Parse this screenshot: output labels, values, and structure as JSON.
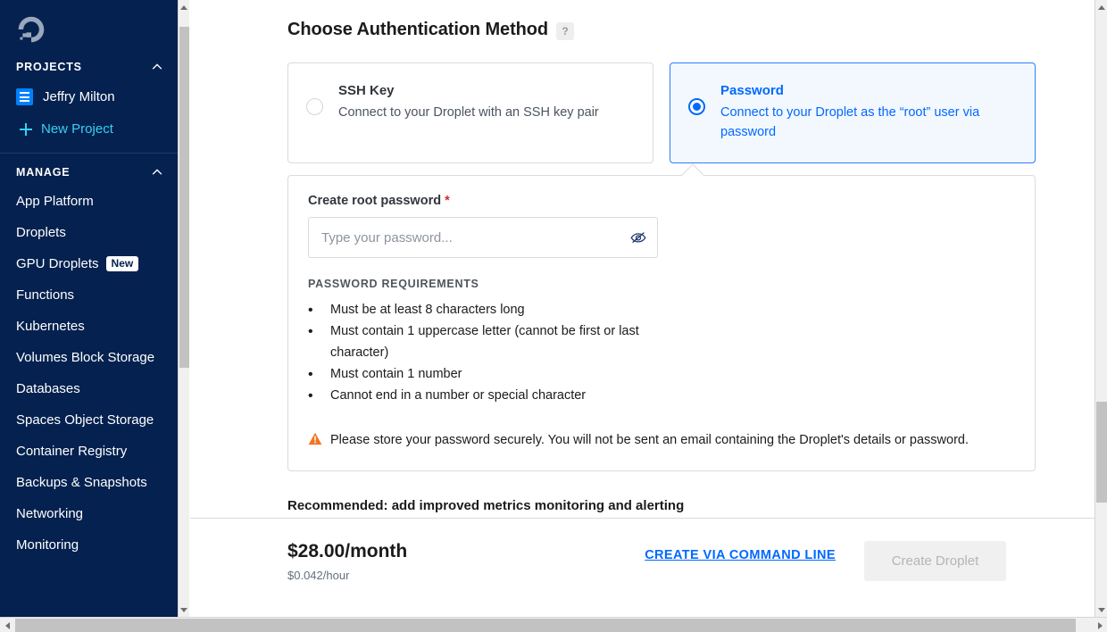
{
  "sidebar": {
    "logo_icon": "digitalocean-logo",
    "projects_section": {
      "label": "PROJECTS",
      "collapse_icon": "chevron-up-icon",
      "project_name": "Jeffry Milton",
      "project_icon": "project-list-icon",
      "new_project_label": "New Project",
      "new_project_icon": "plus-icon"
    },
    "manage_section": {
      "label": "MANAGE",
      "collapse_icon": "chevron-up-icon",
      "items": [
        {
          "label": "App Platform"
        },
        {
          "label": "Droplets"
        },
        {
          "label": "GPU Droplets",
          "badge": "New"
        },
        {
          "label": "Functions"
        },
        {
          "label": "Kubernetes"
        },
        {
          "label": "Volumes Block Storage"
        },
        {
          "label": "Databases"
        },
        {
          "label": "Spaces Object Storage"
        },
        {
          "label": "Container Registry"
        },
        {
          "label": "Backups & Snapshots"
        },
        {
          "label": "Networking"
        },
        {
          "label": "Monitoring"
        }
      ]
    }
  },
  "main": {
    "page_title": "Choose Authentication Method",
    "help_badge": "?",
    "auth_methods": [
      {
        "title": "SSH Key",
        "description": "Connect to your Droplet with an SSH key pair",
        "selected": false
      },
      {
        "title": "Password",
        "description": "Connect to your Droplet as the “root” user via password",
        "selected": true
      }
    ],
    "password_panel": {
      "field_label": "Create root password",
      "required_mark": "*",
      "input_placeholder": "Type your password...",
      "input_value": "",
      "toggle_icon": "eye-slash-icon",
      "requirements_heading": "PASSWORD REQUIREMENTS",
      "requirements": [
        "Must be at least 8 characters long",
        "Must contain 1 uppercase letter (cannot be first or last character)",
        "Must contain 1 number",
        "Cannot end in a number or special character"
      ],
      "warning_icon": "warning-triangle-icon",
      "warning_text": "Please store your password securely. You will not be sent an email containing the Droplet's details or password."
    },
    "next_section_peek": "Recommended: add improved metrics monitoring and alerting"
  },
  "footer": {
    "price_monthly": "$28.00/month",
    "price_hourly": "$0.042/hour",
    "cli_link_label": "CREATE VIA COMMAND LINE",
    "create_button_label": "Create Droplet",
    "create_button_disabled": true
  },
  "colors": {
    "sidebar_bg": "#04214f",
    "accent_blue": "#0069ff",
    "link_cyan": "#36d1f5",
    "selected_card_bg": "#f3f8ff",
    "warning_orange": "#f1751f",
    "required_red": "#cf2d2d"
  },
  "scrollbars": {
    "sidebar_vertical": "visible",
    "main_vertical": "visible",
    "window_horizontal": "visible"
  }
}
